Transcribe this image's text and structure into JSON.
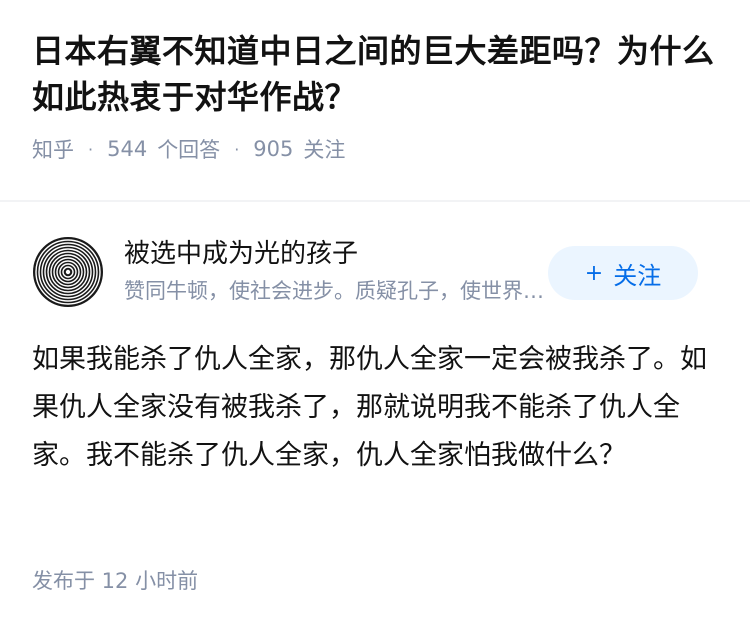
{
  "question": {
    "title": "日本右翼不知道中日之间的巨大差距吗？为什么如此热衷于对华作战？",
    "source": "知乎",
    "answer_count": "544",
    "answer_label": "个回答",
    "follower_count": "905",
    "follower_label": "关注"
  },
  "author": {
    "name": "被选中成为光的孩子",
    "bio": "赞同牛顿，使社会进步。质疑孔子，使世界和平。",
    "avatar_icon": "concentric-circles-avatar",
    "follow_label": "关注",
    "follow_icon": "plus-icon"
  },
  "answer": {
    "content": "如果我能杀了仇人全家，那仇人全家一定会被我杀了。如果仇人全家没有被我杀了，那就说明我不能杀了仇人全家。我不能杀了仇人全家，仇人全家怕我做什么？",
    "time": "发布于 12 小时前"
  },
  "colors": {
    "text_primary": "#121212",
    "text_secondary": "#8590a6",
    "brand_blue": "#056de8",
    "follow_bg": "#ebf5ff"
  }
}
